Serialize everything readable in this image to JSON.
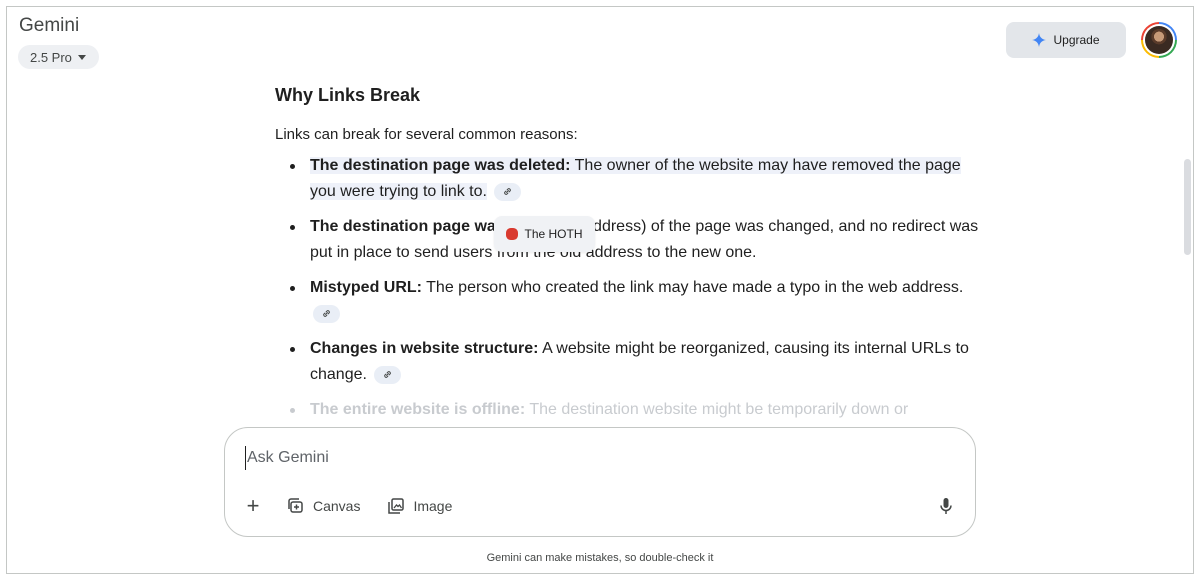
{
  "header": {
    "app_title": "Gemini",
    "model_label": "2.5 Pro",
    "upgrade_label": "Upgrade"
  },
  "response": {
    "heading": "Why Links Break",
    "intro": "Links can break for several common reasons:",
    "items": [
      {
        "title": "The destination page was deleted:",
        "body": " The owner of the website may have removed the page you were trying to link to."
      },
      {
        "title": "The destination page wa",
        "body": "e URL (web address) of the page was changed, and no redirect was put in place to send users from the old address to the new one."
      },
      {
        "title": "Mistyped URL:",
        "body": " The person who created the link may have made a typo in the web address."
      },
      {
        "title": "Changes in website structure:",
        "body": " A website might be reorganized, causing its internal URLs to change."
      },
      {
        "title": "The entire website is offline:",
        "body": " The destination website might be temporarily down or"
      }
    ]
  },
  "tooltip": {
    "source_name": "The HOTH"
  },
  "composer": {
    "placeholder": "Ask Gemini",
    "tools": {
      "canvas_label": "Canvas",
      "image_label": "Image"
    }
  },
  "footer": {
    "disclaimer": "Gemini can make mistakes, so double-check it"
  },
  "icons": {
    "model_dropdown": "caret-down-icon",
    "upgrade": "sparkle-icon",
    "source_link": "link-icon",
    "add": "plus-icon",
    "canvas": "canvas-icon",
    "image": "image-icon",
    "mic": "microphone-icon"
  },
  "colors": {
    "sparkle_blue": "#4285f4",
    "source_highlight": "#eef1f9"
  }
}
